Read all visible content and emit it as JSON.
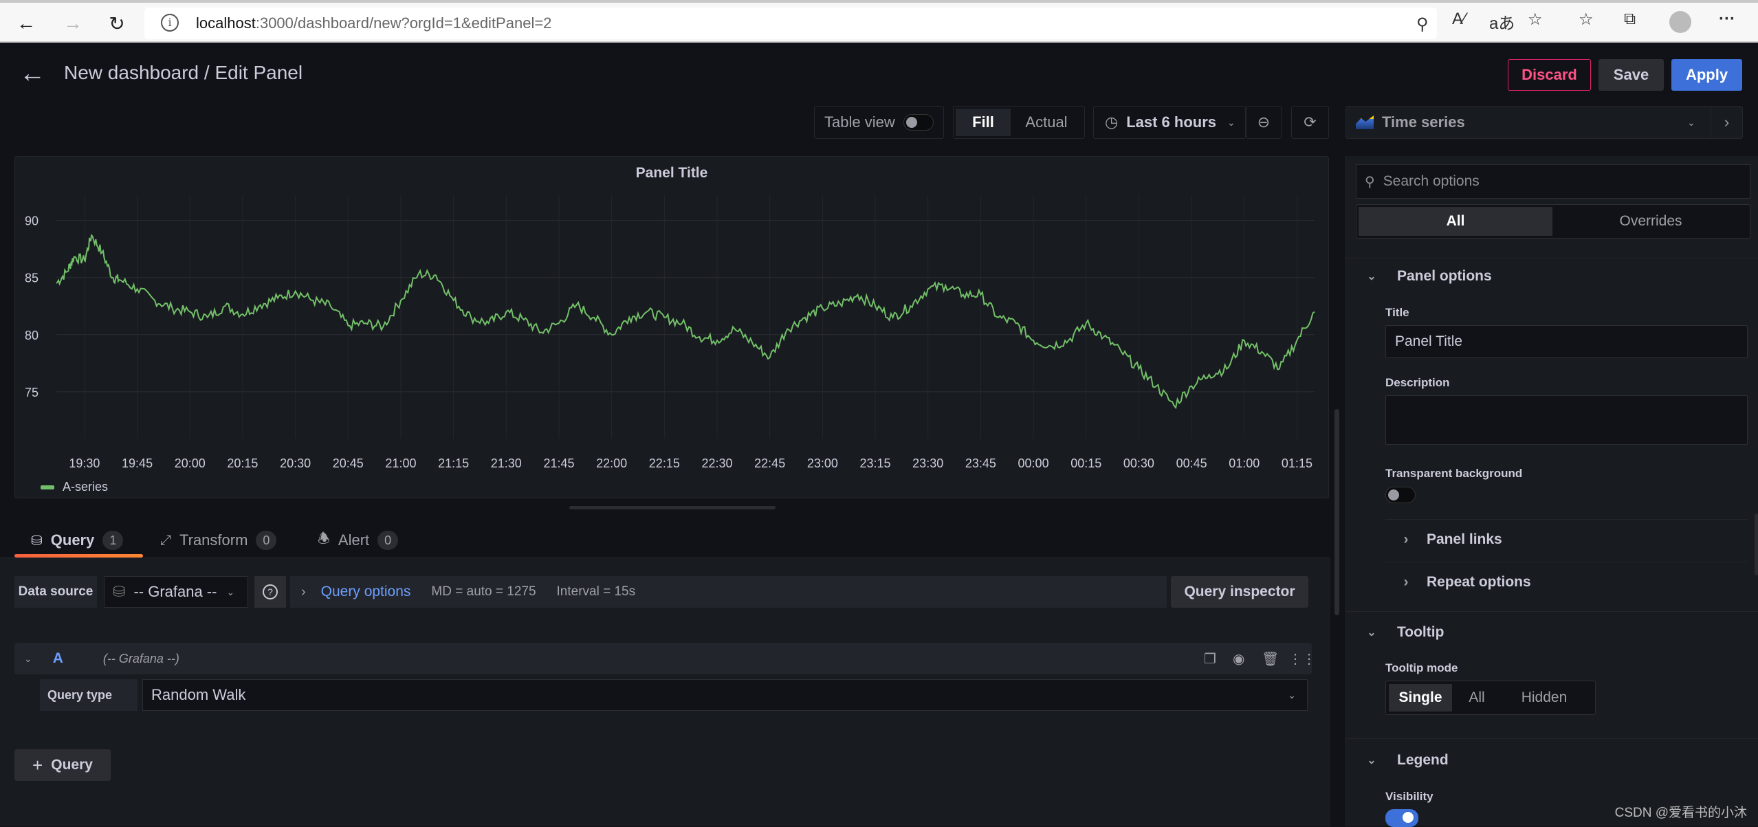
{
  "browser": {
    "url_host": "localhost",
    "url_rest": ":3000/dashboard/new?orgId=1&editPanel=2",
    "icons": [
      "back-icon",
      "forward-icon",
      "reload-icon",
      "site-info-icon",
      "key-icon",
      "read-aloud-icon",
      "translate-icon",
      "add-favorite-icon",
      "favorites-icon",
      "collections-icon",
      "profile-icon",
      "more-icon"
    ]
  },
  "header": {
    "title": "New dashboard / Edit Panel",
    "discard": "Discard",
    "save": "Save",
    "apply": "Apply"
  },
  "toolbar": {
    "table_view": "Table view",
    "table_view_on": false,
    "fill": "Fill",
    "actual": "Actual",
    "selected_mode": "Fill",
    "time_range": "Last 6 hours",
    "visualization": "Time series"
  },
  "panel": {
    "title": "Panel Title",
    "legend": "A-series"
  },
  "chart_data": {
    "type": "line",
    "title": "Panel Title",
    "xlabel": "",
    "ylabel": "",
    "ylim": [
      71.5,
      91
    ],
    "yticks": [
      90,
      85,
      80,
      75
    ],
    "xticks": [
      "19:30",
      "19:45",
      "20:00",
      "20:15",
      "20:30",
      "20:45",
      "21:00",
      "21:15",
      "21:30",
      "21:45",
      "22:00",
      "22:15",
      "22:30",
      "22:45",
      "23:00",
      "23:15",
      "23:30",
      "23:45",
      "00:00",
      "00:15",
      "00:30",
      "00:45",
      "01:00",
      "01:15"
    ],
    "grid": true,
    "legend_placement": "bottom-left",
    "series": [
      {
        "name": "A-series",
        "color": "#73bf69",
        "x": [
          "19:22",
          "19:25",
          "19:27",
          "19:30",
          "19:32",
          "19:35",
          "19:38",
          "19:40",
          "19:45",
          "19:50",
          "19:55",
          "20:00",
          "20:05",
          "20:10",
          "20:15",
          "20:20",
          "20:25",
          "20:30",
          "20:35",
          "20:40",
          "20:45",
          "20:50",
          "20:55",
          "21:00",
          "21:05",
          "21:10",
          "21:15",
          "21:20",
          "21:25",
          "21:30",
          "21:35",
          "21:40",
          "21:45",
          "21:50",
          "21:55",
          "22:00",
          "22:05",
          "22:10",
          "22:15",
          "22:20",
          "22:25",
          "22:30",
          "22:35",
          "22:40",
          "22:45",
          "22:50",
          "22:55",
          "23:00",
          "23:05",
          "23:10",
          "23:15",
          "23:20",
          "23:25",
          "23:30",
          "23:35",
          "23:40",
          "23:45",
          "23:50",
          "23:55",
          "00:00",
          "00:05",
          "00:10",
          "00:15",
          "00:20",
          "00:25",
          "00:30",
          "00:35",
          "00:40",
          "00:45",
          "00:50",
          "00:55",
          "01:00",
          "01:05",
          "01:10",
          "01:15",
          "01:20"
        ],
        "values": [
          84.5,
          85.5,
          86.8,
          86.5,
          88.7,
          87.2,
          85.0,
          84.8,
          84.0,
          83.0,
          82.3,
          82.0,
          81.5,
          82.5,
          81.8,
          82.6,
          83.2,
          83.8,
          83.0,
          82.5,
          80.8,
          81.0,
          80.7,
          83.0,
          85.3,
          85.2,
          83.0,
          81.5,
          81.0,
          82.0,
          81.3,
          80.2,
          81.0,
          82.6,
          81.5,
          80.0,
          81.5,
          82.0,
          81.5,
          81.0,
          79.8,
          79.5,
          80.5,
          79.3,
          78.0,
          80.5,
          81.5,
          82.3,
          82.7,
          83.5,
          82.5,
          81.5,
          82.5,
          84.0,
          84.3,
          83.5,
          83.5,
          81.5,
          81.0,
          79.5,
          79.0,
          79.5,
          81.0,
          79.8,
          78.5,
          77.0,
          75.5,
          73.8,
          75.5,
          76.5,
          77.0,
          79.5,
          78.5,
          77.0,
          79.5,
          82.0
        ]
      }
    ]
  },
  "query_tabs": [
    {
      "label": "Query",
      "count": "1",
      "active": true
    },
    {
      "label": "Transform",
      "count": "0",
      "active": false
    },
    {
      "label": "Alert",
      "count": "0",
      "active": false
    }
  ],
  "query": {
    "datasource_label": "Data source",
    "datasource": "-- Grafana --",
    "query_options": "Query options",
    "md": "MD = auto = 1275",
    "interval": "Interval = 15s",
    "inspector": "Query inspector",
    "row_ref": "A",
    "row_ds": "(-- Grafana --)",
    "query_type_label": "Query type",
    "query_type": "Random Walk",
    "add_query": "Query"
  },
  "options": {
    "search_placeholder": "Search options",
    "tab_all": "All",
    "tab_overrides": "Overrides",
    "panel_options": "Panel options",
    "title_label": "Title",
    "title_value": "Panel Title",
    "description_label": "Description",
    "description_value": "",
    "transparent_label": "Transparent background",
    "transparent_on": false,
    "panel_links": "Panel links",
    "repeat_options": "Repeat options",
    "tooltip": "Tooltip",
    "tooltip_mode_label": "Tooltip mode",
    "tooltip_modes": [
      "Single",
      "All",
      "Hidden"
    ],
    "tooltip_selected": "Single",
    "legend": "Legend",
    "visibility_label": "Visibility",
    "visibility_on": true
  },
  "watermark": "CSDN @爱看书的小沐"
}
